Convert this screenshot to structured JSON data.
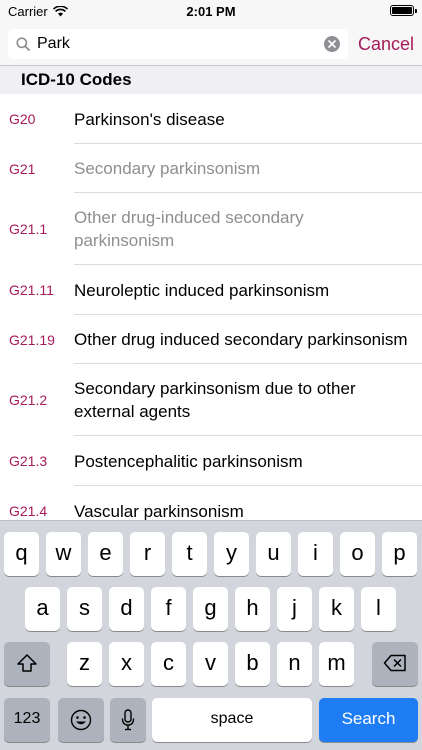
{
  "status_bar": {
    "carrier": "Carrier",
    "time": "2:01 PM"
  },
  "search": {
    "value": "Park",
    "cancel_label": "Cancel"
  },
  "section_header": "ICD-10 Codes",
  "colors": {
    "accent": "#a51c5a",
    "search_key": "#1e7cf5"
  },
  "results": [
    {
      "code": "G20",
      "description": "Parkinson's disease",
      "dimmed": false
    },
    {
      "code": "G21",
      "description": "Secondary parkinsonism",
      "dimmed": true
    },
    {
      "code": "G21.1",
      "description": "Other drug-induced secondary parkinsonism",
      "dimmed": true
    },
    {
      "code": "G21.11",
      "description": "Neuroleptic induced parkinsonism",
      "dimmed": false
    },
    {
      "code": "G21.19",
      "description": "Other drug induced secondary parkinsonism",
      "dimmed": false
    },
    {
      "code": "G21.2",
      "description": "Secondary parkinsonism due to other external agents",
      "dimmed": false
    },
    {
      "code": "G21.3",
      "description": "Postencephalitic parkinsonism",
      "dimmed": false
    },
    {
      "code": "G21.4",
      "description": "Vascular parkinsonism",
      "dimmed": false
    }
  ],
  "keyboard": {
    "row1": [
      "q",
      "w",
      "e",
      "r",
      "t",
      "y",
      "u",
      "i",
      "o",
      "p"
    ],
    "row2": [
      "a",
      "s",
      "d",
      "f",
      "g",
      "h",
      "j",
      "k",
      "l"
    ],
    "row3": [
      "z",
      "x",
      "c",
      "v",
      "b",
      "n",
      "m"
    ],
    "numbers_label": "123",
    "space_label": "space",
    "search_label": "Search"
  }
}
